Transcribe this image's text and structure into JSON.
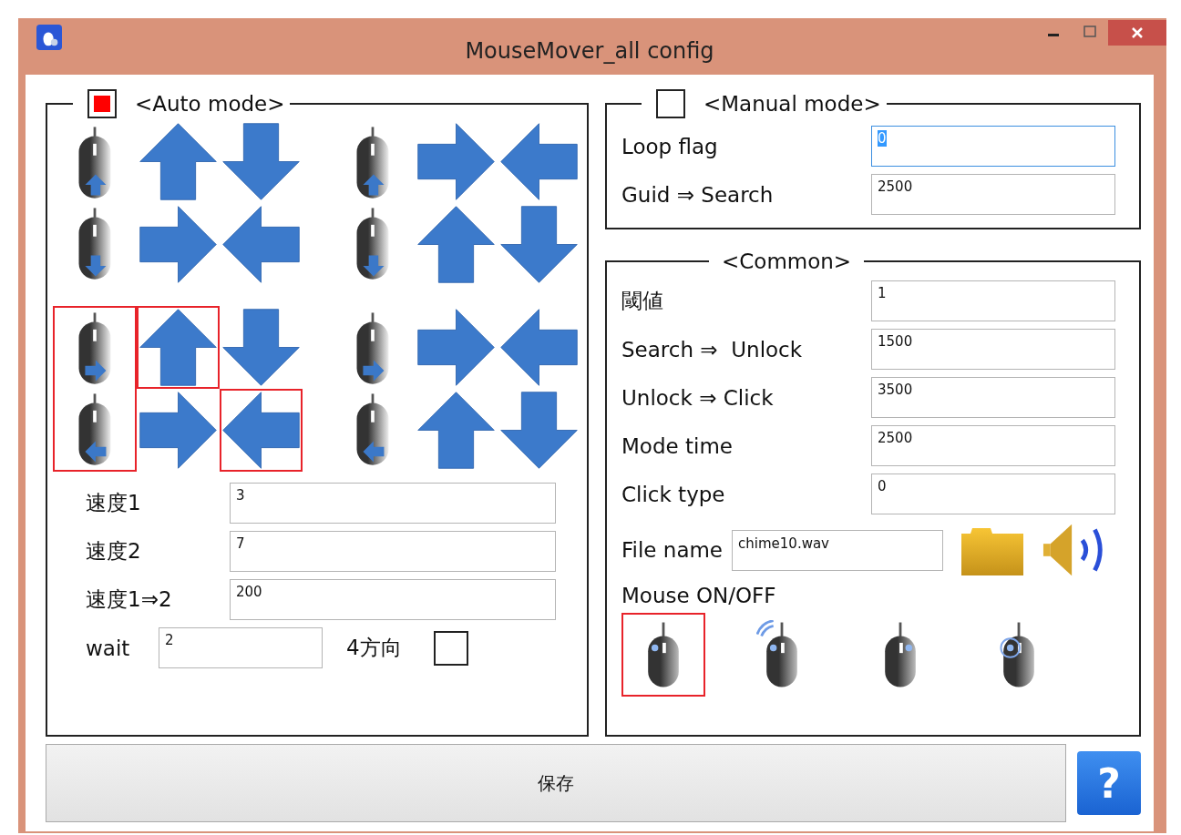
{
  "window": {
    "title": "MouseMover_all config"
  },
  "auto_mode": {
    "title": "<Auto mode>",
    "checked": true,
    "patterns": [
      {
        "selected": false,
        "mice": [
          {
            "kind": "up"
          },
          {
            "kind": "down"
          }
        ],
        "arrows": [
          {
            "kind": "up",
            "selected": false
          },
          {
            "kind": "down",
            "selected": false
          },
          {
            "kind": "right",
            "selected": false
          },
          {
            "kind": "left",
            "selected": false
          }
        ]
      },
      {
        "selected": false,
        "mice": [
          {
            "kind": "up"
          },
          {
            "kind": "down"
          }
        ],
        "arrows": [
          {
            "kind": "right",
            "selected": false
          },
          {
            "kind": "left",
            "selected": false
          },
          {
            "kind": "up",
            "selected": false
          },
          {
            "kind": "down",
            "selected": false
          }
        ]
      },
      {
        "selected": true,
        "mice": [
          {
            "kind": "right"
          },
          {
            "kind": "left"
          }
        ],
        "arrows": [
          {
            "kind": "up",
            "selected": true
          },
          {
            "kind": "down",
            "selected": false
          },
          {
            "kind": "right",
            "selected": false
          },
          {
            "kind": "left",
            "selected": true
          }
        ]
      },
      {
        "selected": false,
        "mice": [
          {
            "kind": "right"
          },
          {
            "kind": "left"
          }
        ],
        "arrows": [
          {
            "kind": "right",
            "selected": false
          },
          {
            "kind": "left",
            "selected": false
          },
          {
            "kind": "up",
            "selected": false
          },
          {
            "kind": "down",
            "selected": false
          }
        ]
      }
    ],
    "fields": [
      {
        "label": "速度1",
        "value": "3"
      },
      {
        "label": "速度2",
        "value": "7"
      },
      {
        "label": "速度1⇒2",
        "value": "200"
      }
    ],
    "wait": {
      "label": "wait",
      "value": "2"
    },
    "four_directions": {
      "label": "4方向",
      "checked": false
    }
  },
  "manual_mode": {
    "title": "<Manual mode>",
    "checked": false,
    "fields": [
      {
        "label": "Loop flag",
        "value": "0",
        "focused": true
      },
      {
        "label": "Guid ⇒ Search",
        "value": "2500",
        "focused": false
      }
    ]
  },
  "common": {
    "title": "<Common>",
    "fields": [
      {
        "label": "閾値",
        "value": "1"
      },
      {
        "label": "Search ⇒  Unlock",
        "value": "1500"
      },
      {
        "label": "Unlock ⇒ Click",
        "value": "3500"
      },
      {
        "label": "Mode time",
        "value": "2500"
      },
      {
        "label": "Click type",
        "value": "0"
      }
    ],
    "file_name": {
      "label": "File name",
      "value": "chime10.wav"
    },
    "mouse_label": "Mouse ON/OFF",
    "mouse_modes": [
      {
        "kind": "plain",
        "selected": true
      },
      {
        "kind": "wireless",
        "selected": false
      },
      {
        "kind": "side-dot",
        "selected": false
      },
      {
        "kind": "ring",
        "selected": false
      }
    ]
  },
  "save_button": "保存",
  "help_button": "?"
}
